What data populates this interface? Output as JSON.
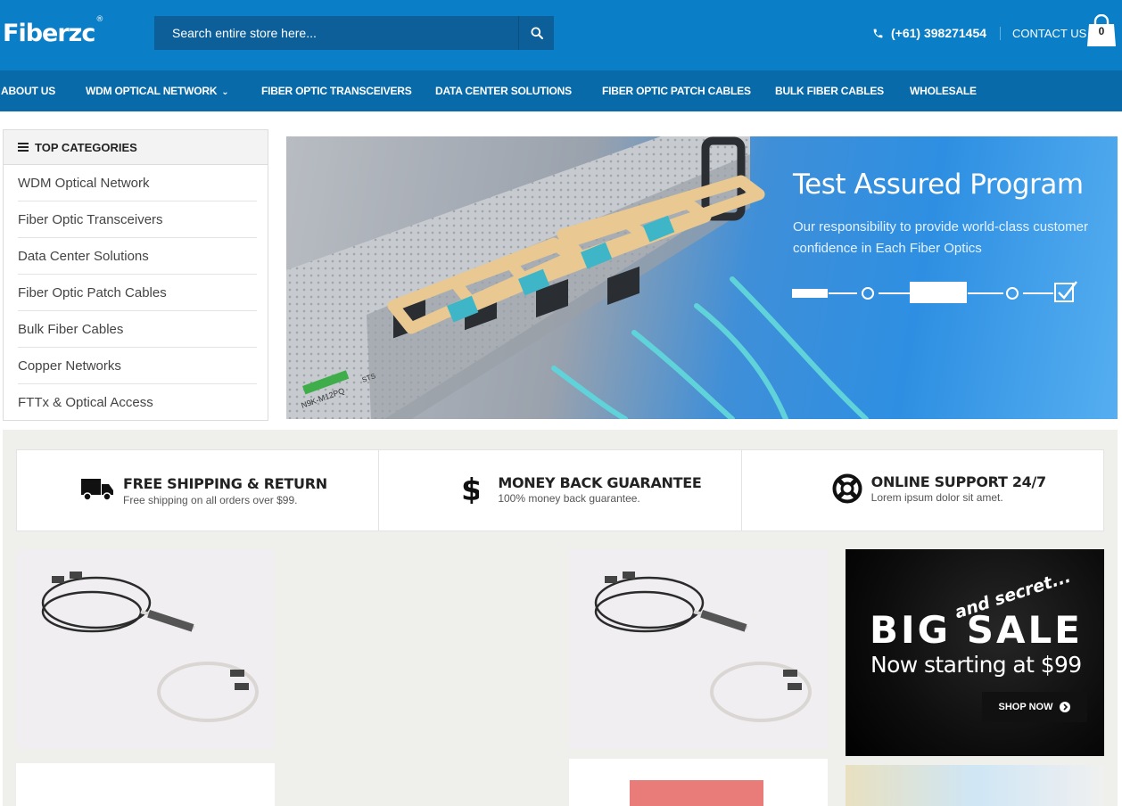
{
  "header": {
    "logo_text": "Fiberzc",
    "logo_mark": "®",
    "search_placeholder": "Search entire store here...",
    "phone": "(+61) 398271454",
    "contact_label": "CONTACT US",
    "cart_count": "0",
    "brand_color": "#0a7ec6"
  },
  "nav": {
    "items": [
      "ABOUT US",
      "WDM OPTICAL NETWORK",
      "FIBER OPTIC TRANSCEIVERS",
      "DATA CENTER SOLUTIONS",
      "FIBER OPTIC PATCH CABLES",
      "BULK FIBER CABLES",
      "WHOLESALE"
    ]
  },
  "sidebar": {
    "title": "TOP CATEGORIES",
    "items": [
      "WDM Optical Network",
      "Fiber Optic Transceivers",
      "Data Center Solutions",
      "Fiber Optic Patch Cables",
      "Bulk Fiber Cables",
      "Copper Networks",
      "FTTx & Optical Access"
    ]
  },
  "banner": {
    "title": "Test Assured Program",
    "subtitle": "Our responsibility to provide world-class customer confidence in Each Fiber Optics",
    "module_label": "N9K-M12PQ",
    "port_label": "STS"
  },
  "features": [
    {
      "title": "FREE SHIPPING & RETURN",
      "desc": "Free shipping on all orders over $99.",
      "icon": "truck-icon"
    },
    {
      "title": "MONEY BACK GUARANTEE",
      "desc": "100% money back guarantee.",
      "icon": "dollar-icon"
    },
    {
      "title": "ONLINE SUPPORT 24/7",
      "desc": "Lorem ipsum dolor sit amet.",
      "icon": "lifebuoy-icon"
    }
  ],
  "sale": {
    "secret": "and secret...",
    "big": "BIG SALE",
    "now": "Now starting at $99",
    "button": "SHOP NOW"
  }
}
